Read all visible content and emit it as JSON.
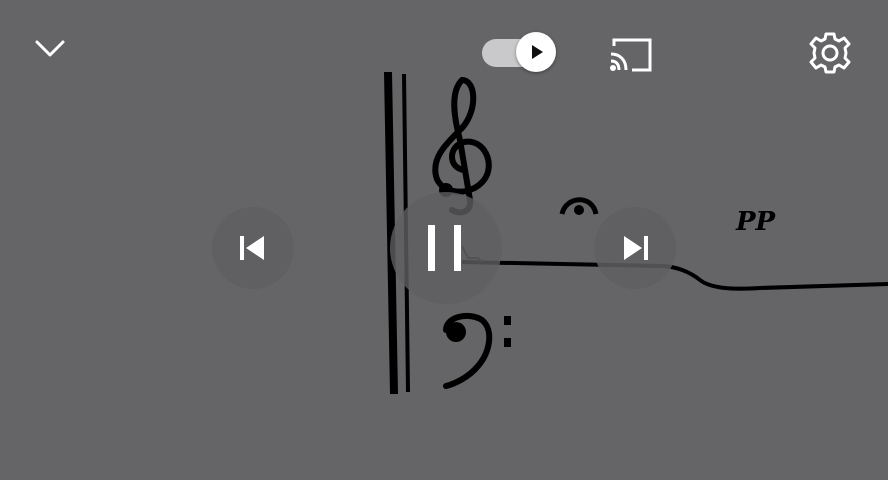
{
  "video_frame": {
    "dynamic_marking": "PP"
  },
  "controls": {
    "autoplay_on": true,
    "is_playing": true
  },
  "icons": {
    "collapse": "chevron-down-icon",
    "autoplay": "play-icon",
    "cast": "cast-icon",
    "settings": "gear-icon",
    "previous": "skip-previous-icon",
    "pause": "pause-icon",
    "next": "skip-next-icon"
  },
  "colors": {
    "background": "#656467",
    "icon": "#ffffff",
    "overlay_button": "#5f5e61"
  }
}
